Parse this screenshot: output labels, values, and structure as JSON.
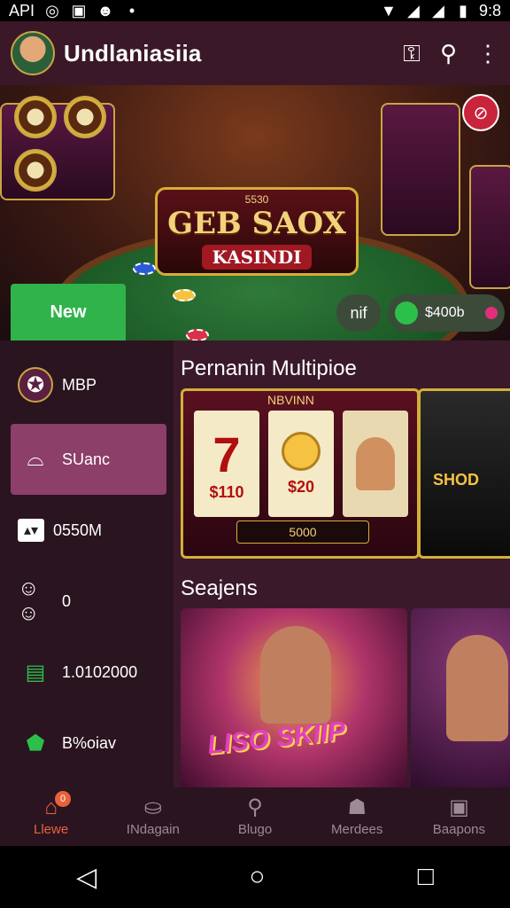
{
  "status_bar": {
    "carrier": "API",
    "time": "9:8"
  },
  "header": {
    "title": "Undlaniasiia"
  },
  "hero": {
    "sign_title": "GEB SAOX",
    "sign_subtitle": "KASINDI",
    "sign_top": "5530",
    "new_button": "New",
    "pill_a": "nif",
    "pill_b": "$400b"
  },
  "sidebar": {
    "items": [
      {
        "label": "MBP",
        "icon": "badge-icon"
      },
      {
        "label": "SUanc",
        "icon": "chat-icon"
      },
      {
        "label": "0550M",
        "icon": "ticket-icon"
      },
      {
        "label": "0",
        "icon": "people-icon"
      },
      {
        "label": "1.0102000",
        "icon": "document-icon"
      },
      {
        "label": "B%oiav",
        "icon": "shield-icon"
      }
    ]
  },
  "main": {
    "section1_title": "Pernanin Multipioe",
    "slot1": {
      "header": "NBVINN",
      "reel1": "7",
      "reel1_value": "$110",
      "reel2_value": "$20",
      "footer": "5000"
    },
    "slot2": {
      "label": "SHOD"
    },
    "section2_title": "Seajens",
    "promo1_text": "LISO SKIIP"
  },
  "bottom_nav": {
    "items": [
      {
        "label": "Llewe",
        "icon": "home-icon",
        "badge": "0"
      },
      {
        "label": "INdagain",
        "icon": "bucket-icon"
      },
      {
        "label": "Blugo",
        "icon": "search-icon"
      },
      {
        "label": "Merdees",
        "icon": "person-icon"
      },
      {
        "label": "Baapons",
        "icon": "window-icon"
      }
    ]
  },
  "colors": {
    "accent": "#e8613a",
    "header_bg": "#3a1828",
    "sidebar_active": "#8c3f68",
    "new_button": "#2fb34a"
  }
}
